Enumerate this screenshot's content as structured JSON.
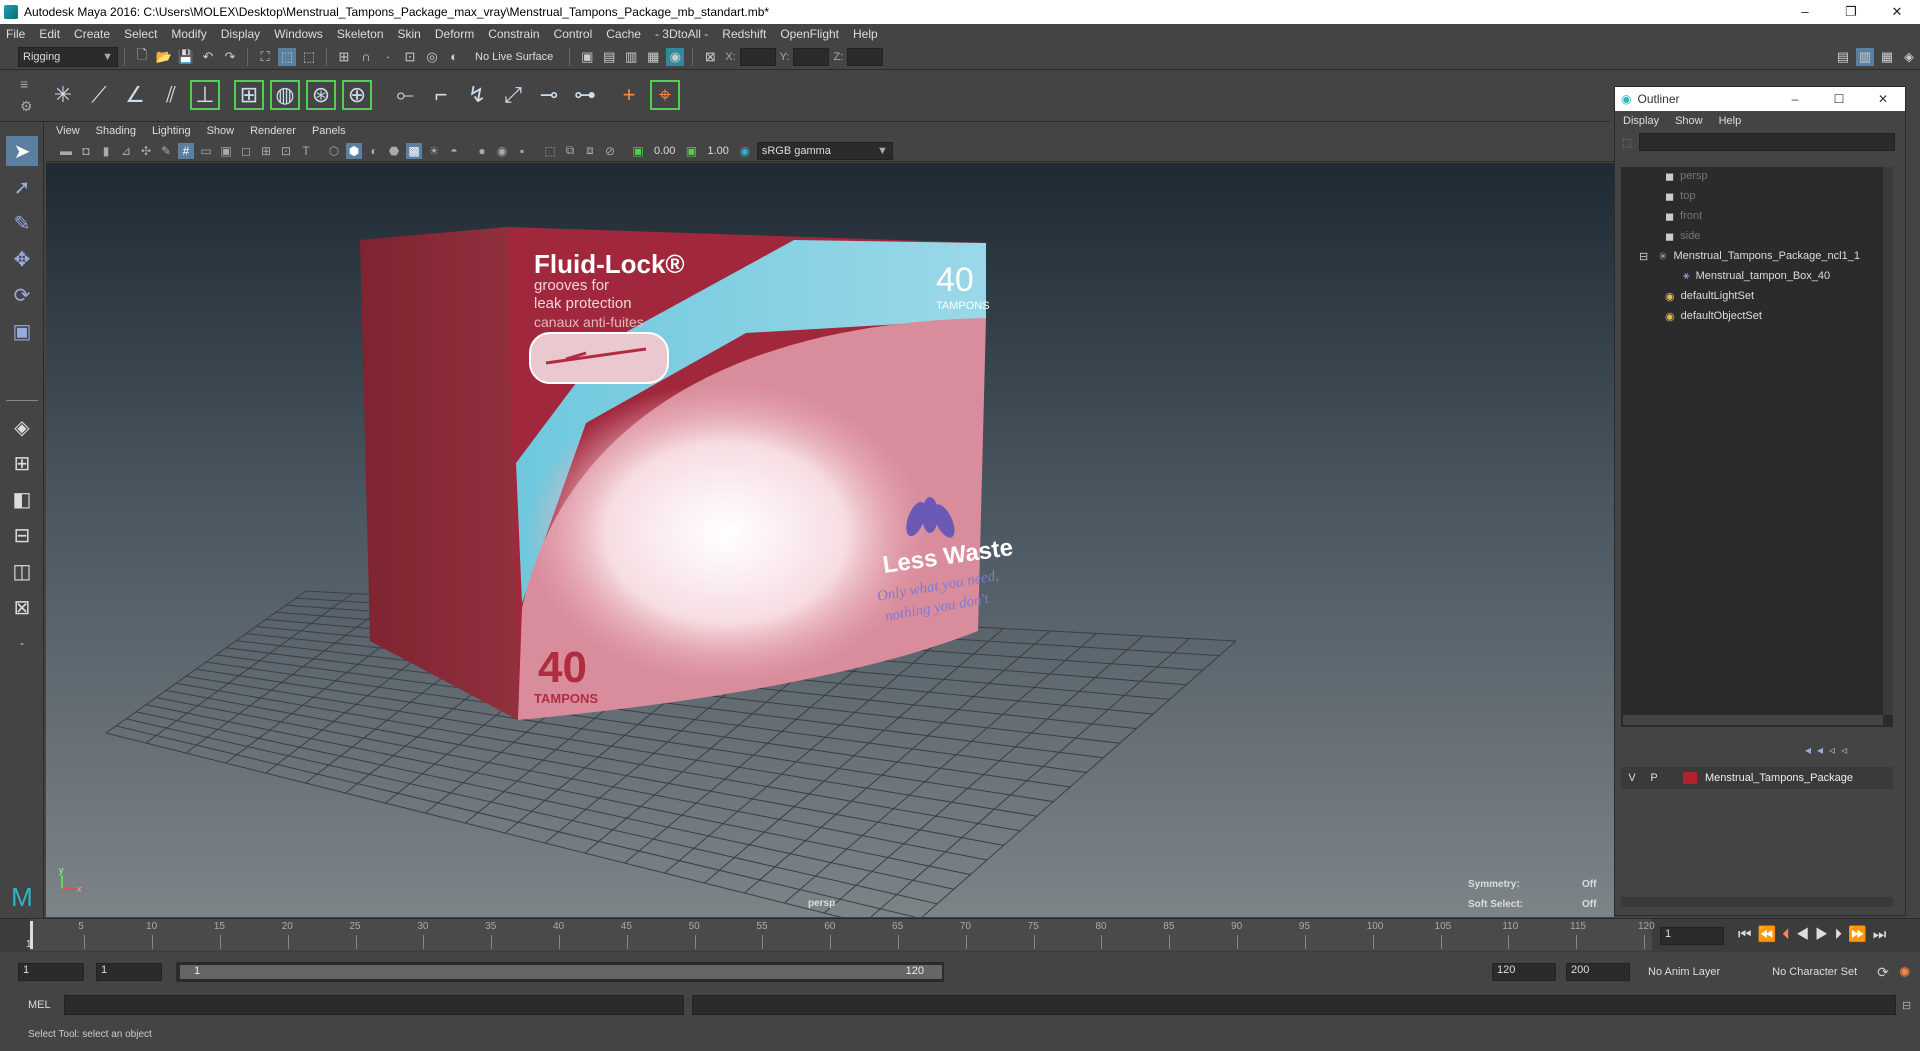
{
  "window": {
    "title": "Autodesk Maya 2016: C:\\Users\\MOLEX\\Desktop\\Menstrual_Tampons_Package_max_vray\\Menstrual_Tampons_Package_mb_standart.mb*",
    "min": "–",
    "max": "❐",
    "close": "✕"
  },
  "menus": [
    "File",
    "Edit",
    "Create",
    "Select",
    "Modify",
    "Display",
    "Windows",
    "Skeleton",
    "Skin",
    "Deform",
    "Constrain",
    "Control",
    "Cache",
    "- 3DtoAll -",
    "Redshift",
    "OpenFlight",
    "Help"
  ],
  "status": {
    "mode": "Rigging",
    "live_surface": "No Live Surface",
    "x_label": "X:",
    "y_label": "Y:",
    "z_label": "Z:"
  },
  "viewport": {
    "menus": [
      "View",
      "Shading",
      "Lighting",
      "Show",
      "Renderer",
      "Panels"
    ],
    "near_value": "0.00",
    "far_value": "1.00",
    "color_space": "sRGB gamma",
    "camera_label": "persp",
    "symmetry_label": "Symmetry:",
    "symmetry_value": "Off",
    "soft_select_label": "Soft Select:",
    "soft_select_value": "Off",
    "axis_y": "y",
    "axis_x": "x"
  },
  "package": {
    "brand": "Fluid-Lock®",
    "line1": "grooves for",
    "line2": "leak protection",
    "line3": "canaux anti-fuites",
    "count": "40",
    "count_label": "TAMPONS",
    "side_count": "40",
    "side_label": "TAMPONS",
    "slogan": "Less Waste",
    "tagline1": "Only what you need,",
    "tagline2": "nothing you don't"
  },
  "outliner": {
    "title": "Outliner",
    "menus": [
      "Display",
      "Show",
      "Help"
    ],
    "items": [
      "persp",
      "top",
      "front",
      "side",
      "Menstrual_Tampons_Package_ncl1_1",
      "Menstrual_tampon_Box_40",
      "defaultLightSet",
      "defaultObjectSet"
    ],
    "layer": {
      "v": "V",
      "p": "P",
      "name": "Menstrual_Tampons_Package",
      "color": "#b3202e"
    }
  },
  "timeline": {
    "ticks": [
      "5",
      "10",
      "15",
      "20",
      "25",
      "30",
      "35",
      "40",
      "45",
      "50",
      "55",
      "60",
      "65",
      "70",
      "75",
      "80",
      "85",
      "90",
      "95",
      "100",
      "105",
      "110",
      "115",
      "120"
    ],
    "start_tick": "1",
    "current_frame": "1"
  },
  "range": {
    "start": "1",
    "playback_start": "1",
    "slider_start": "1",
    "slider_end": "120",
    "playback_end": "120",
    "end": "200",
    "anim_layer": "No Anim Layer",
    "character_set": "No Character Set"
  },
  "command": {
    "label": "MEL"
  },
  "help": {
    "text": "Select Tool: select an object"
  }
}
